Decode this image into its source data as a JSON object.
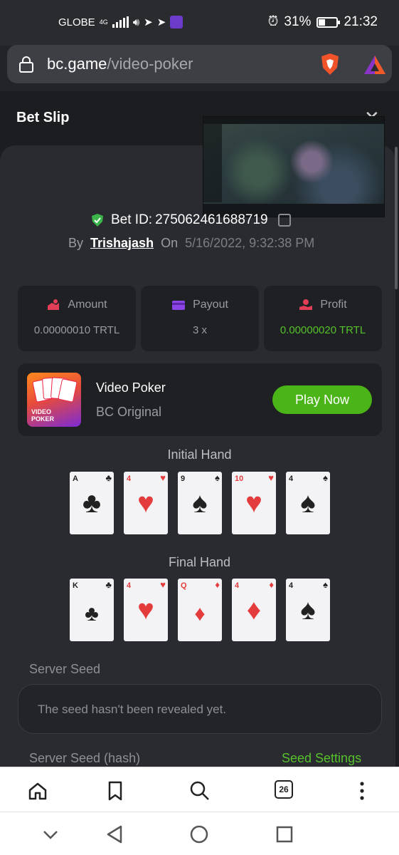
{
  "status_bar": {
    "carrier": "GLOBE",
    "network": "4G",
    "battery": "31%",
    "time": "21:32"
  },
  "browser": {
    "url_domain": "bc.game",
    "url_path": "/video-poker",
    "tab_count": "26"
  },
  "page": {
    "title": "Bet Slip",
    "bet_id_label": "Bet ID:",
    "bet_id": "275062461688719",
    "by_label": "By",
    "username": "Trishajash",
    "on_label": "On",
    "date": "5/16/2022, 9:32:38 PM",
    "stats": [
      {
        "label": "Amount",
        "value": "0.00000010 TRTL"
      },
      {
        "label": "Payout",
        "value": "3 x"
      },
      {
        "label": "Profit",
        "value": "0.00000020 TRTL"
      }
    ],
    "game": {
      "name": "Video Poker",
      "provider": "BC Original",
      "play_label": "Play Now",
      "thumb_text_1": "VIDEO",
      "thumb_text_2": "POKER"
    },
    "initial_hand_title": "Initial Hand",
    "initial_hand": [
      {
        "rank": "A",
        "suit": "♣",
        "color": "black"
      },
      {
        "rank": "4",
        "suit": "♥",
        "color": "red"
      },
      {
        "rank": "9",
        "suit": "♠",
        "color": "black"
      },
      {
        "rank": "10",
        "suit": "♥",
        "color": "red"
      },
      {
        "rank": "4",
        "suit": "♠",
        "color": "black"
      }
    ],
    "final_hand_title": "Final Hand",
    "final_hand": [
      {
        "rank": "K",
        "suit": "♣",
        "color": "black",
        "face": true
      },
      {
        "rank": "4",
        "suit": "♥",
        "color": "red"
      },
      {
        "rank": "Q",
        "suit": "♦",
        "color": "red",
        "face": true
      },
      {
        "rank": "4",
        "suit": "♦",
        "color": "red"
      },
      {
        "rank": "4",
        "suit": "♠",
        "color": "black"
      }
    ],
    "server_seed_label": "Server Seed",
    "server_seed_value": "The seed hasn't been revealed yet.",
    "server_seed_hash_label": "Server Seed (hash)",
    "seed_settings_label": "Seed Settings"
  },
  "colors": {
    "accent_green": "#4ab418",
    "profit_green": "#56c12b",
    "background": "#1c1d20"
  }
}
